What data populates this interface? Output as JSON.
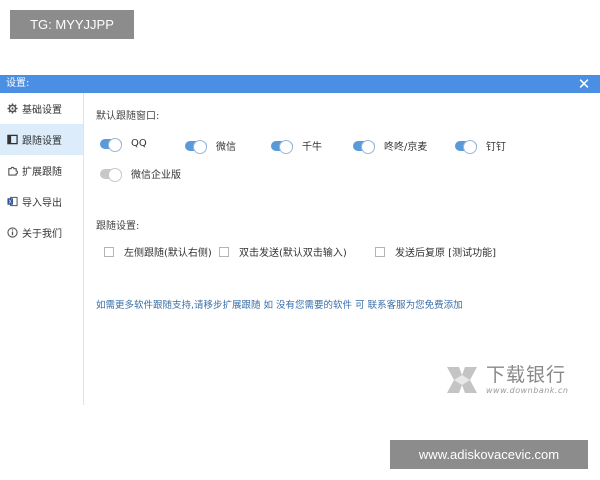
{
  "overlay_top": "TG: MYYJJPP",
  "overlay_bottom": "www.adiskovacevic.com",
  "window": {
    "title": "设置:",
    "close_glyph": "✕"
  },
  "sidebar": {
    "items": [
      {
        "label": "基础设置",
        "icon": "gear-icon"
      },
      {
        "label": "跟随设置",
        "icon": "window-icon",
        "active": true
      },
      {
        "label": "扩展跟随",
        "icon": "puzzle-icon"
      },
      {
        "label": "导入导出",
        "icon": "excel-icon"
      },
      {
        "label": "关于我们",
        "icon": "info-icon"
      }
    ]
  },
  "main": {
    "section_default_title": "默认跟随窗口:",
    "toggles": [
      {
        "label": "QQ",
        "on": true
      },
      {
        "label": "微信",
        "on": true
      },
      {
        "label": "千牛",
        "on": true
      },
      {
        "label": "咚咚/京麦",
        "on": true
      },
      {
        "label": "钉钉",
        "on": true
      },
      {
        "label": "微信企业版",
        "on": false
      }
    ],
    "section_follow_title": "跟随设置:",
    "checks": [
      {
        "label": "左侧跟随(默认右侧)",
        "checked": false
      },
      {
        "label": "双击发送(默认双击输入)",
        "checked": false
      },
      {
        "label": "发送后复原 [测试功能]",
        "checked": false
      }
    ],
    "hint": "如需更多软件跟随支持,请移步扩展跟随 如 没有您需要的软件 可 联系客服为您免费添加"
  },
  "watermark": {
    "brand": "下载银行",
    "url": "www.downbank.cn"
  },
  "colors": {
    "accent": "#4a8fe3",
    "active_bg": "#dcecfb",
    "toggle_on": "#5a9ad9",
    "toggle_off": "#c8c8c8",
    "hint": "#3a6ea8"
  }
}
